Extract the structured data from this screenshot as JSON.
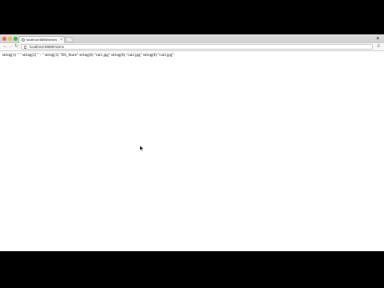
{
  "browser": {
    "tab": {
      "title": "localhost:8888/mixins",
      "close_glyph": "×"
    },
    "address_bar": {
      "url": "localhost:8888/mixins"
    },
    "nav": {
      "back_glyph": "←",
      "forward_glyph": "→",
      "reload_glyph": "↻"
    },
    "menu_glyph": "≡",
    "profile_glyph": "♟"
  },
  "page": {
    "output_text": "string(1) \" \" string(2) \" - \" string(3) \"DS_Store\" string(8) \"cat1.jpg\" string(8) \"cat2.jpg\" string(8) \"cat3.jpg\""
  },
  "icons": [
    "favicon-icon",
    "new-tab-icon",
    "profile-icon",
    "back-arrow-icon",
    "forward-arrow-icon",
    "reload-icon",
    "page-icon",
    "menu-icon",
    "mouse-cursor-icon"
  ]
}
